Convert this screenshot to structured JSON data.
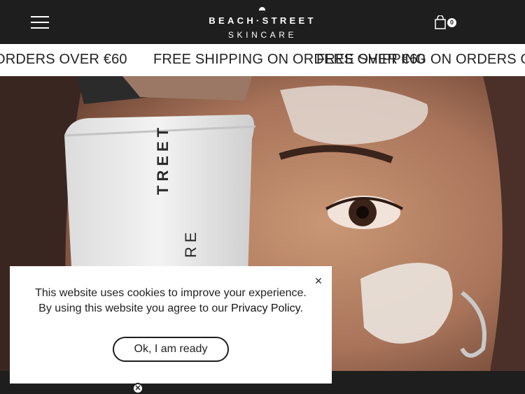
{
  "header": {
    "menu_icon": "hamburger-menu-icon",
    "logo_text": "BEACH·STREET",
    "logo_subtext": "SKINCARE",
    "cart_icon": "shopping-bag-icon",
    "cart_count": "0"
  },
  "announcement": {
    "segments": [
      "ORDERS OVER €60",
      "FREE SHIPPING ON ORDERS OVER €60",
      "FREE SHIPPING ON ORDERS O"
    ]
  },
  "hero": {
    "image_subject": "model holding skincare tube"
  },
  "cookie_banner": {
    "message_line1": "This website uses cookies to improve your experience.",
    "message_line2_prefix": "By using this website you agree to our ",
    "privacy_link": "Privacy Policy",
    "message_line2_suffix": ".",
    "accept_button": "Ok, I am ready",
    "close_icon": "close-icon"
  },
  "floating_close": {
    "icon": "close-circle-icon",
    "glyph": "✕"
  }
}
